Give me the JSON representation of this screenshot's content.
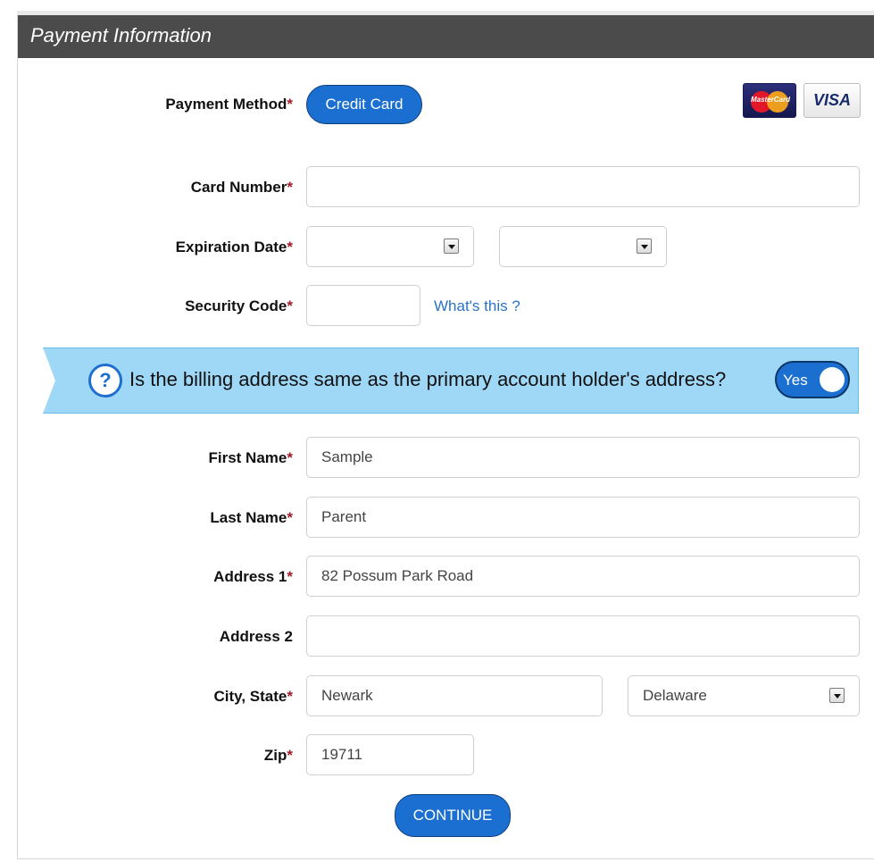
{
  "header": {
    "title": "Payment Information"
  },
  "payment_method": {
    "label": "Payment Method",
    "value": "Credit Card"
  },
  "card_logos": {
    "mastercard": "MasterCard",
    "visa": "VISA"
  },
  "card_number": {
    "label": "Card Number",
    "value": ""
  },
  "expiration": {
    "label": "Expiration Date",
    "month": "",
    "year": ""
  },
  "security_code": {
    "label": "Security Code",
    "value": "",
    "help_link": "What's this ?"
  },
  "billing_question": {
    "text": "Is the billing address same as the primary account holder's address?",
    "toggle": "Yes",
    "icon": "question-icon"
  },
  "first_name": {
    "label": "First Name",
    "value": "Sample"
  },
  "last_name": {
    "label": "Last Name",
    "value": "Parent"
  },
  "address1": {
    "label": "Address 1",
    "value": "82 Possum Park Road"
  },
  "address2": {
    "label": "Address 2",
    "value": ""
  },
  "city_state": {
    "label": "City, State",
    "city": "Newark",
    "state": "Delaware"
  },
  "zip": {
    "label": "Zip",
    "value": "19711"
  },
  "continue_label": "CONTINUE",
  "required_marker": "*",
  "colors": {
    "accent": "#1b6fd1",
    "header_bg": "#4b4b4b",
    "banner_bg": "#9fd8f7",
    "required": "#a01d2a"
  }
}
